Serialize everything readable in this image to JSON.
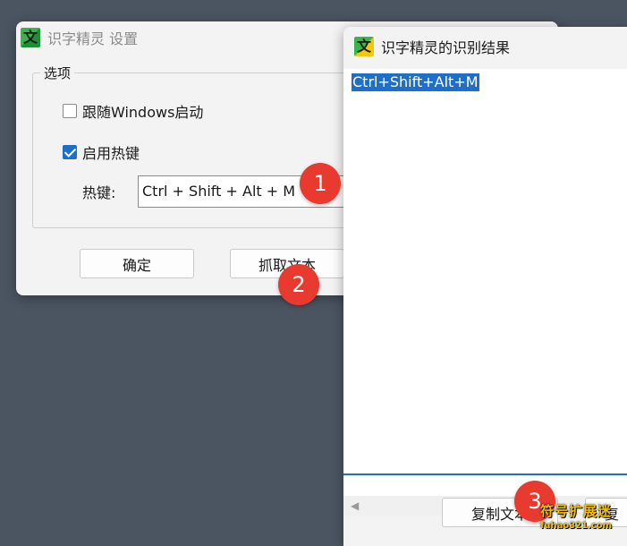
{
  "settings_window": {
    "title": "识字精灵 设置",
    "icon_glyph": "文",
    "options_group_label": "选项",
    "autostart_checkbox": {
      "label": "跟随Windows启动",
      "checked": false
    },
    "hotkey_checkbox": {
      "label": "启用热键",
      "checked": true
    },
    "hotkey_label": "热键:",
    "hotkey_value": "Ctrl + Shift + Alt + M",
    "ok_button": "确定",
    "grab_button": "抓取文本"
  },
  "results_window": {
    "title": "识字精灵的识别结果",
    "icon_glyph": "文",
    "selected_text": "Ctrl+Shift+Alt+M",
    "copy_button": "复制文本",
    "second_button": "复"
  },
  "annotations": [
    "1",
    "2",
    "3"
  ],
  "watermark": {
    "text": "符号扩展迷",
    "url": "fuhao321.com"
  },
  "colors": {
    "accent": "#1f6fc9",
    "badge": "#e83a2e",
    "desktop": "#4b5562"
  }
}
